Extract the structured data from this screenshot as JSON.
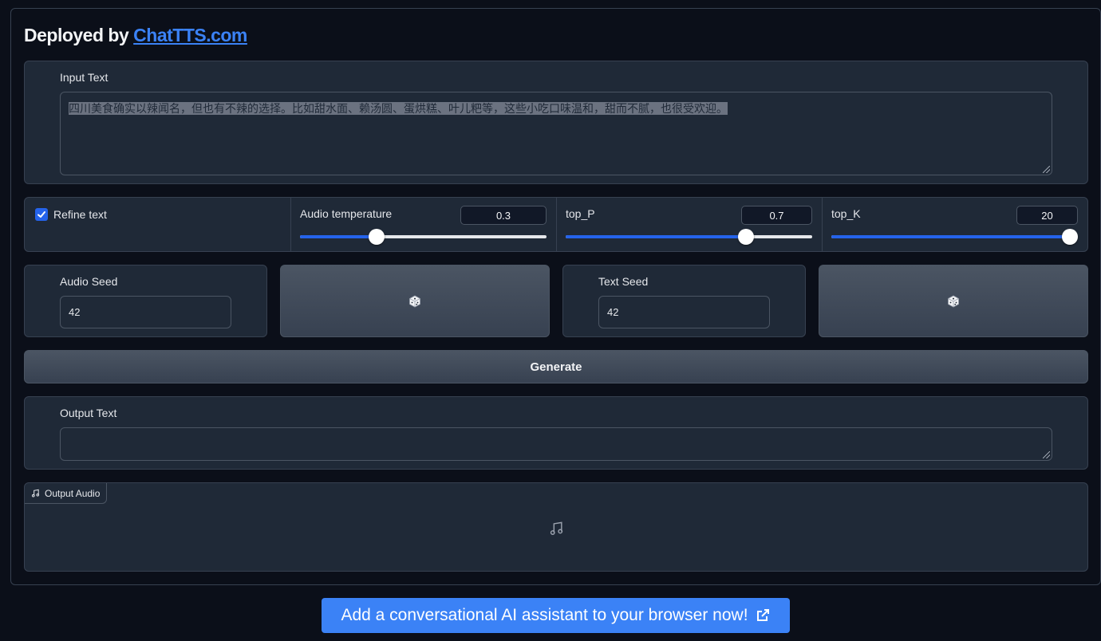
{
  "header": {
    "prefix": "Deployed by ",
    "link_text": "ChatTTS.com"
  },
  "input_text": {
    "label": "Input Text",
    "value": "四川美食确实以辣闻名，但也有不辣的选择。比如甜水面、赖汤圆、蛋烘糕、叶儿粑等，这些小吃口味温和，甜而不腻，也很受欢迎。"
  },
  "options": {
    "refine_text": {
      "label": "Refine text",
      "checked": true
    },
    "audio_temperature": {
      "label": "Audio temperature",
      "value": "0.3",
      "fraction": 0.31
    },
    "top_p": {
      "label": "top_P",
      "value": "0.7",
      "fraction": 0.73
    },
    "top_k": {
      "label": "top_K",
      "value": "20",
      "fraction": 1.0
    }
  },
  "seeds": {
    "audio_seed": {
      "label": "Audio Seed",
      "value": "42",
      "button_icon": "dice-icon"
    },
    "text_seed": {
      "label": "Text Seed",
      "value": "42",
      "button_icon": "dice-icon"
    }
  },
  "generate": {
    "label": "Generate"
  },
  "output_text": {
    "label": "Output Text",
    "value": ""
  },
  "output_audio": {
    "label": "Output Audio",
    "icon": "music-note-icon"
  },
  "banner": {
    "text": "Add a conversational AI assistant to your browser now!",
    "icon": "external-link-icon"
  },
  "colors": {
    "accent": "#2563eb",
    "link": "#3b82f6",
    "background": "#0b0f19",
    "panel": "#1f2937"
  }
}
